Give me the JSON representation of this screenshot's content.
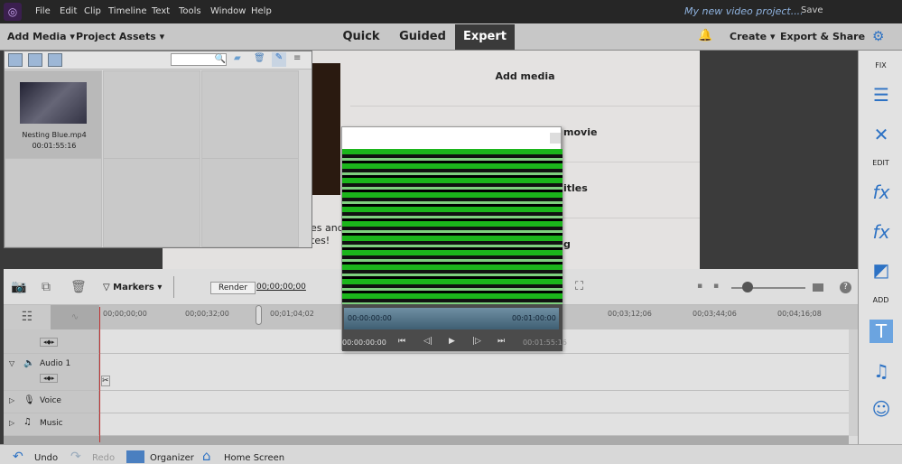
{
  "menubar": {
    "items": [
      "File",
      "Edit",
      "Clip",
      "Timeline",
      "Text",
      "Tools",
      "Window",
      "Help"
    ],
    "project_title": "My new video project....",
    "save": "Save"
  },
  "toolbar": {
    "add_media": "Add Media",
    "project_assets": "Project Assets",
    "tabs": [
      "Quick",
      "Guided",
      "Expert"
    ],
    "active_tab": "Expert",
    "create": "Create",
    "export_share": "Export & Share"
  },
  "assets": {
    "items": [
      {
        "name": "Nesting Blue.mp4",
        "duration": "00:01:55:16"
      }
    ]
  },
  "guide": {
    "items": [
      "Add media",
      "movie",
      "itles",
      "g"
    ],
    "partial_text": [
      "es and",
      "tes!"
    ]
  },
  "sidebar": {
    "sections": [
      "FIX",
      "EDIT",
      "ADD"
    ]
  },
  "timeline": {
    "markers": "Markers",
    "render": "Render",
    "timecode": "00;00;00;00",
    "ruler": [
      "00;00;00;00",
      "00;00;32;00",
      "00;01;04;02",
      "00;03;12;06",
      "00;03;44;06",
      "00;04;16;08"
    ],
    "tracks": [
      "Audio 1",
      "Voice",
      "Music"
    ]
  },
  "preview": {
    "in": "00:00:00:00",
    "out": "00:01:00:00",
    "current": "00:00:00:00",
    "duration": "00:01:55:16"
  },
  "bottombar": {
    "undo": "Undo",
    "redo": "Redo",
    "organizer": "Organizer",
    "home": "Home Screen"
  },
  "colors": {
    "accent": "#2d72c4",
    "playhead": "#c03030"
  }
}
